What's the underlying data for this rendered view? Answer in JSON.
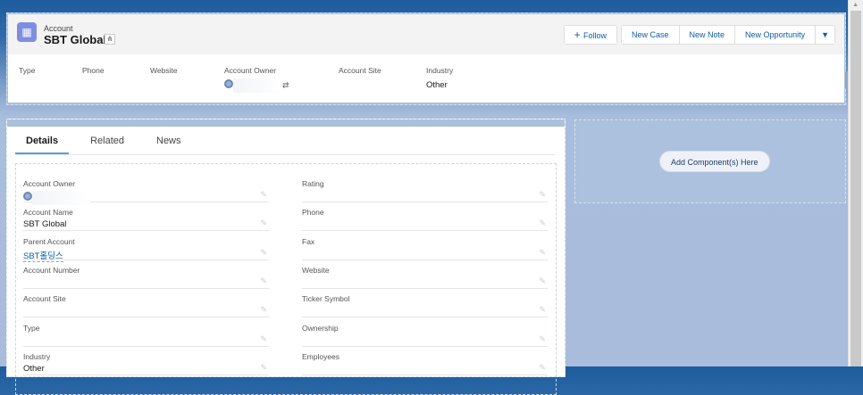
{
  "header": {
    "object_label": "Account",
    "title": "SBT Global",
    "buttons": {
      "follow": "Follow",
      "new_case": "New Case",
      "new_note": "New Note",
      "new_opportunity": "New Opportunity"
    },
    "fields": [
      {
        "label": "Type",
        "value": ""
      },
      {
        "label": "Phone",
        "value": ""
      },
      {
        "label": "Website",
        "value": ""
      },
      {
        "label": "Account Owner",
        "value": ""
      },
      {
        "label": "Account Site",
        "value": ""
      },
      {
        "label": "Industry",
        "value": "Other"
      }
    ]
  },
  "tabs": [
    "Details",
    "Related",
    "News"
  ],
  "details": {
    "left": [
      {
        "label": "Account Owner",
        "value": ""
      },
      {
        "label": "Account Name",
        "value": "SBT Global"
      },
      {
        "label": "Parent Account",
        "value": "SBT홀딩스"
      },
      {
        "label": "Account Number",
        "value": ""
      },
      {
        "label": "Account Site",
        "value": ""
      },
      {
        "label": "Type",
        "value": ""
      },
      {
        "label": "Industry",
        "value": "Other"
      }
    ],
    "right": [
      {
        "label": "Rating",
        "value": ""
      },
      {
        "label": "Phone",
        "value": ""
      },
      {
        "label": "Fax",
        "value": ""
      },
      {
        "label": "Website",
        "value": ""
      },
      {
        "label": "Ticker Symbol",
        "value": ""
      },
      {
        "label": "Ownership",
        "value": ""
      },
      {
        "label": "Employees",
        "value": ""
      }
    ]
  },
  "sidebar": {
    "add_component": "Add Component(s) Here"
  }
}
